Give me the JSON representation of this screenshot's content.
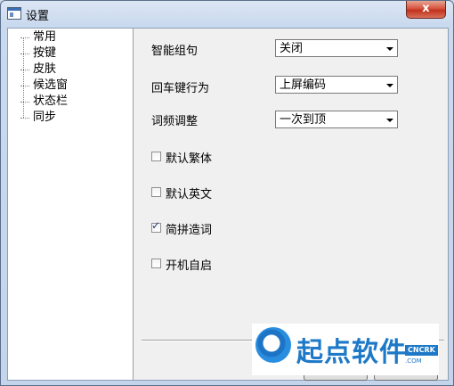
{
  "window": {
    "title": "设置",
    "close_label": "x"
  },
  "tree": {
    "items": [
      "常用",
      "按键",
      "皮肤",
      "候选窗",
      "状态栏",
      "同步"
    ]
  },
  "settings": {
    "rows": [
      {
        "label": "智能组句",
        "value": "关闭"
      },
      {
        "label": "回车键行为",
        "value": "上屏编码"
      },
      {
        "label": "词频调整",
        "value": "一次到顶"
      }
    ],
    "checkboxes": [
      {
        "label": "默认繁体",
        "checked": false
      },
      {
        "label": "默认英文",
        "checked": false
      },
      {
        "label": "简拼造词",
        "checked": true
      },
      {
        "label": "开机自启",
        "checked": false
      }
    ]
  },
  "watermark": {
    "text": "起点软件",
    "badge": "CNCRK",
    "url": ".COM"
  },
  "colors": {
    "title_bg": "#c9d9ee",
    "close": "#c1311c",
    "client": "#f0f0f0",
    "watermark": "#1d79c8"
  }
}
